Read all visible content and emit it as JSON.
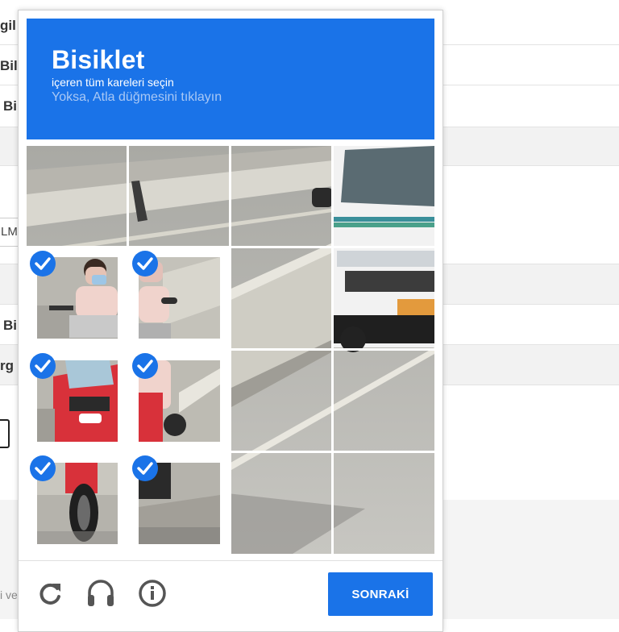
{
  "background_page": {
    "row_labels": [
      "gil",
      "Bilg",
      "Bi",
      "Bi",
      "rg"
    ],
    "field_text": "LM",
    "footer_text": "i ve"
  },
  "captcha": {
    "title": "Bisiklet",
    "instruction": "içeren tüm kareleri seçin",
    "hint": "Yoksa, Atla düğmesini tıklayın",
    "selected_tiles": [
      4,
      5,
      8,
      9,
      12,
      13
    ],
    "next_button": "SONRAKİ",
    "icons": [
      "reload-icon",
      "audio-icon",
      "info-icon"
    ],
    "accent_color": "#1a73e8"
  }
}
